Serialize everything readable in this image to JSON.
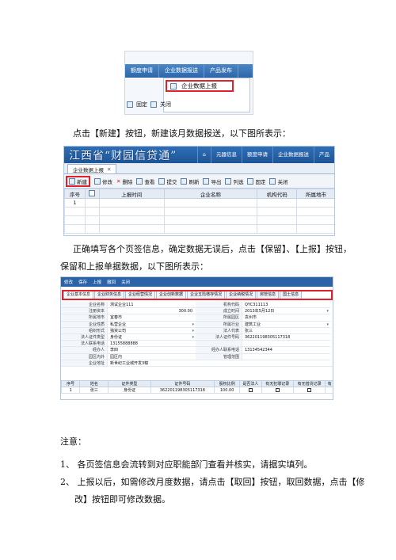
{
  "screenshot1": {
    "menu_tabs": [
      "额度申请",
      "企业数据报送",
      "产品发布"
    ],
    "dropdown_item": "企业数据上报",
    "toolbar": [
      "固定",
      "关闭"
    ]
  },
  "para1": "点击【新建】按钮，新建该月数据报送，以下图所表示：",
  "screenshot2": {
    "app_title": "江西省“财园信贷通”",
    "nav": [
      "⌂",
      "元器信息",
      "额度申请",
      "企业数据报送",
      "产品"
    ],
    "tab_label": "企业数据上报",
    "toolbar": [
      "新建",
      "修改",
      "删除",
      "查看",
      "提交",
      "刷新",
      "导出",
      "列选",
      "固定",
      "关闭"
    ],
    "columns": [
      "序号",
      "",
      "上报时间",
      "企业名称",
      "机构代码",
      "所属地市"
    ],
    "rows": [
      [
        "1",
        "",
        "",
        "",
        "",
        ""
      ]
    ]
  },
  "para2_line1": "正确填写各个页签信息，确定数据无误后，点击【保留】、【上报】按钮，",
  "para2_line2": "保留和上报单据数据，以下图所表示：",
  "screenshot3": {
    "toolbar": [
      "修改",
      "保存",
      "上报",
      "撤回",
      "关闭"
    ],
    "tabs": [
      "企业基本信息",
      "企业财务信息",
      "企业经营情况",
      "企业创新数据",
      "企业五险缴存情况",
      "企业纳税情况",
      "房管信息",
      "国土信息"
    ],
    "form": [
      [
        "企业名称",
        "测试企业111",
        "机构代码",
        "QYC311113"
      ],
      [
        "注册资本",
        "300.00",
        "成立时间",
        "2013年5月12日"
      ],
      [
        "所属地市",
        "宜春市",
        "所属园区",
        "袁州市"
      ],
      [
        "企业性质",
        "私营企业",
        "所属行业",
        "建筑工业"
      ],
      [
        "组织形式",
        "独资公司",
        "法人代表",
        "张三"
      ],
      [
        "法人证件类型",
        "身份证",
        "法人证件号码",
        "362201198305117318"
      ],
      [
        "法人联系电话",
        "13155888888",
        "",
        ""
      ],
      [
        "经办人",
        "李四",
        "经办人联系电话",
        "13134542344"
      ],
      [
        "园区内外",
        "园区内",
        "管理范围",
        ""
      ],
      [
        "企业地址",
        "新世纪工业城开发3幢",
        "",
        ""
      ]
    ],
    "columns": [
      "序号",
      "姓名",
      "证件类型",
      "证件号码",
      "股权比例",
      "是否法人",
      "有无犯罪记录",
      "有无借贷记录",
      "有"
    ],
    "rows": [
      [
        "1",
        "张三",
        "身份证",
        "362201198305117318",
        "100.00",
        "",
        "",
        "",
        ""
      ]
    ]
  },
  "note_title": "注意：",
  "notes": [
    {
      "num": "1、",
      "text": "各页签信息会流转到对应职能部门查看并核实，请据实填列。"
    },
    {
      "num": "2、",
      "text": "上报以后，如需修改月度数据，请点击【取回】按钮，取回数据，点击【修"
    },
    {
      "num": "",
      "text": "改】按钮即可修改数据。"
    }
  ]
}
